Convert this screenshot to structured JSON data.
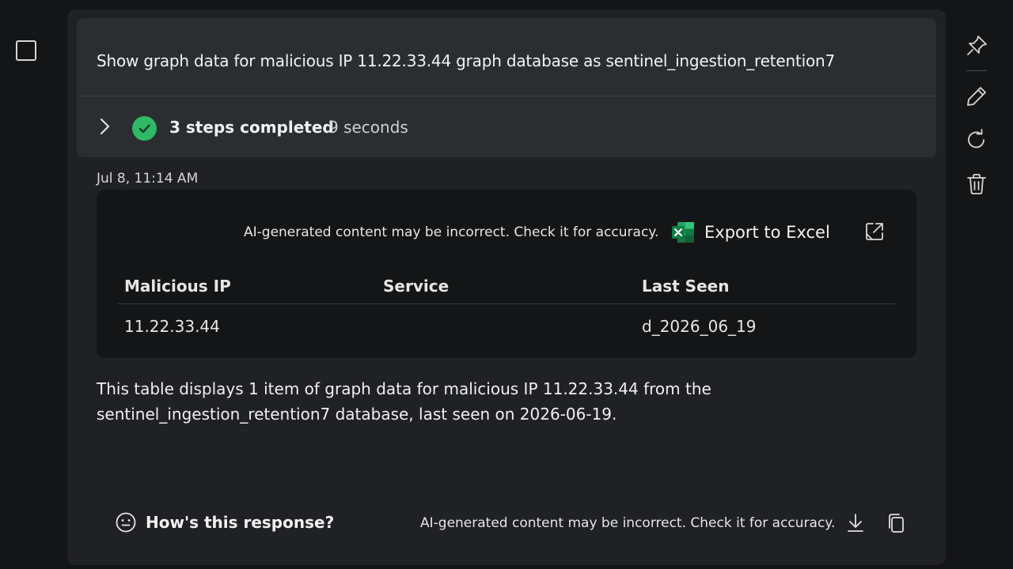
{
  "prompt": {
    "text": "Show graph data for malicious IP 11.22.33.44 graph database as sentinel_ingestion_retention7"
  },
  "steps": {
    "label": "3 steps completed",
    "duration": "9 seconds"
  },
  "response": {
    "timestamp": "Jul 8, 11:14 AM",
    "disclaimer": "AI-generated content may be incorrect. Check it for accuracy.",
    "export_label": "Export to Excel",
    "table": {
      "headers": [
        "Malicious IP",
        "Service",
        "Last Seen"
      ],
      "rows": [
        [
          "11.22.33.44",
          "",
          "d_2026_06_19"
        ]
      ]
    },
    "summary": "This table displays 1 item of graph data for malicious IP 11.22.33.44 from the sentinel_ingestion_retention7 database, last seen on 2026-06-19."
  },
  "footer": {
    "feedback_label": "How's this response?",
    "disclaimer": "AI-generated content may be incorrect. Check it for accuracy."
  },
  "colors": {
    "success_green": "#2fb865",
    "excel_green": "#1f7a45",
    "card_bg": "#1f2124",
    "prompt_bg": "#2b2e31"
  },
  "icons": {
    "side_toolbar": [
      "pin-icon",
      "edit-icon",
      "refresh-icon",
      "delete-icon"
    ],
    "footer": [
      "feedback-face-icon",
      "download-icon",
      "copy-icon"
    ]
  }
}
